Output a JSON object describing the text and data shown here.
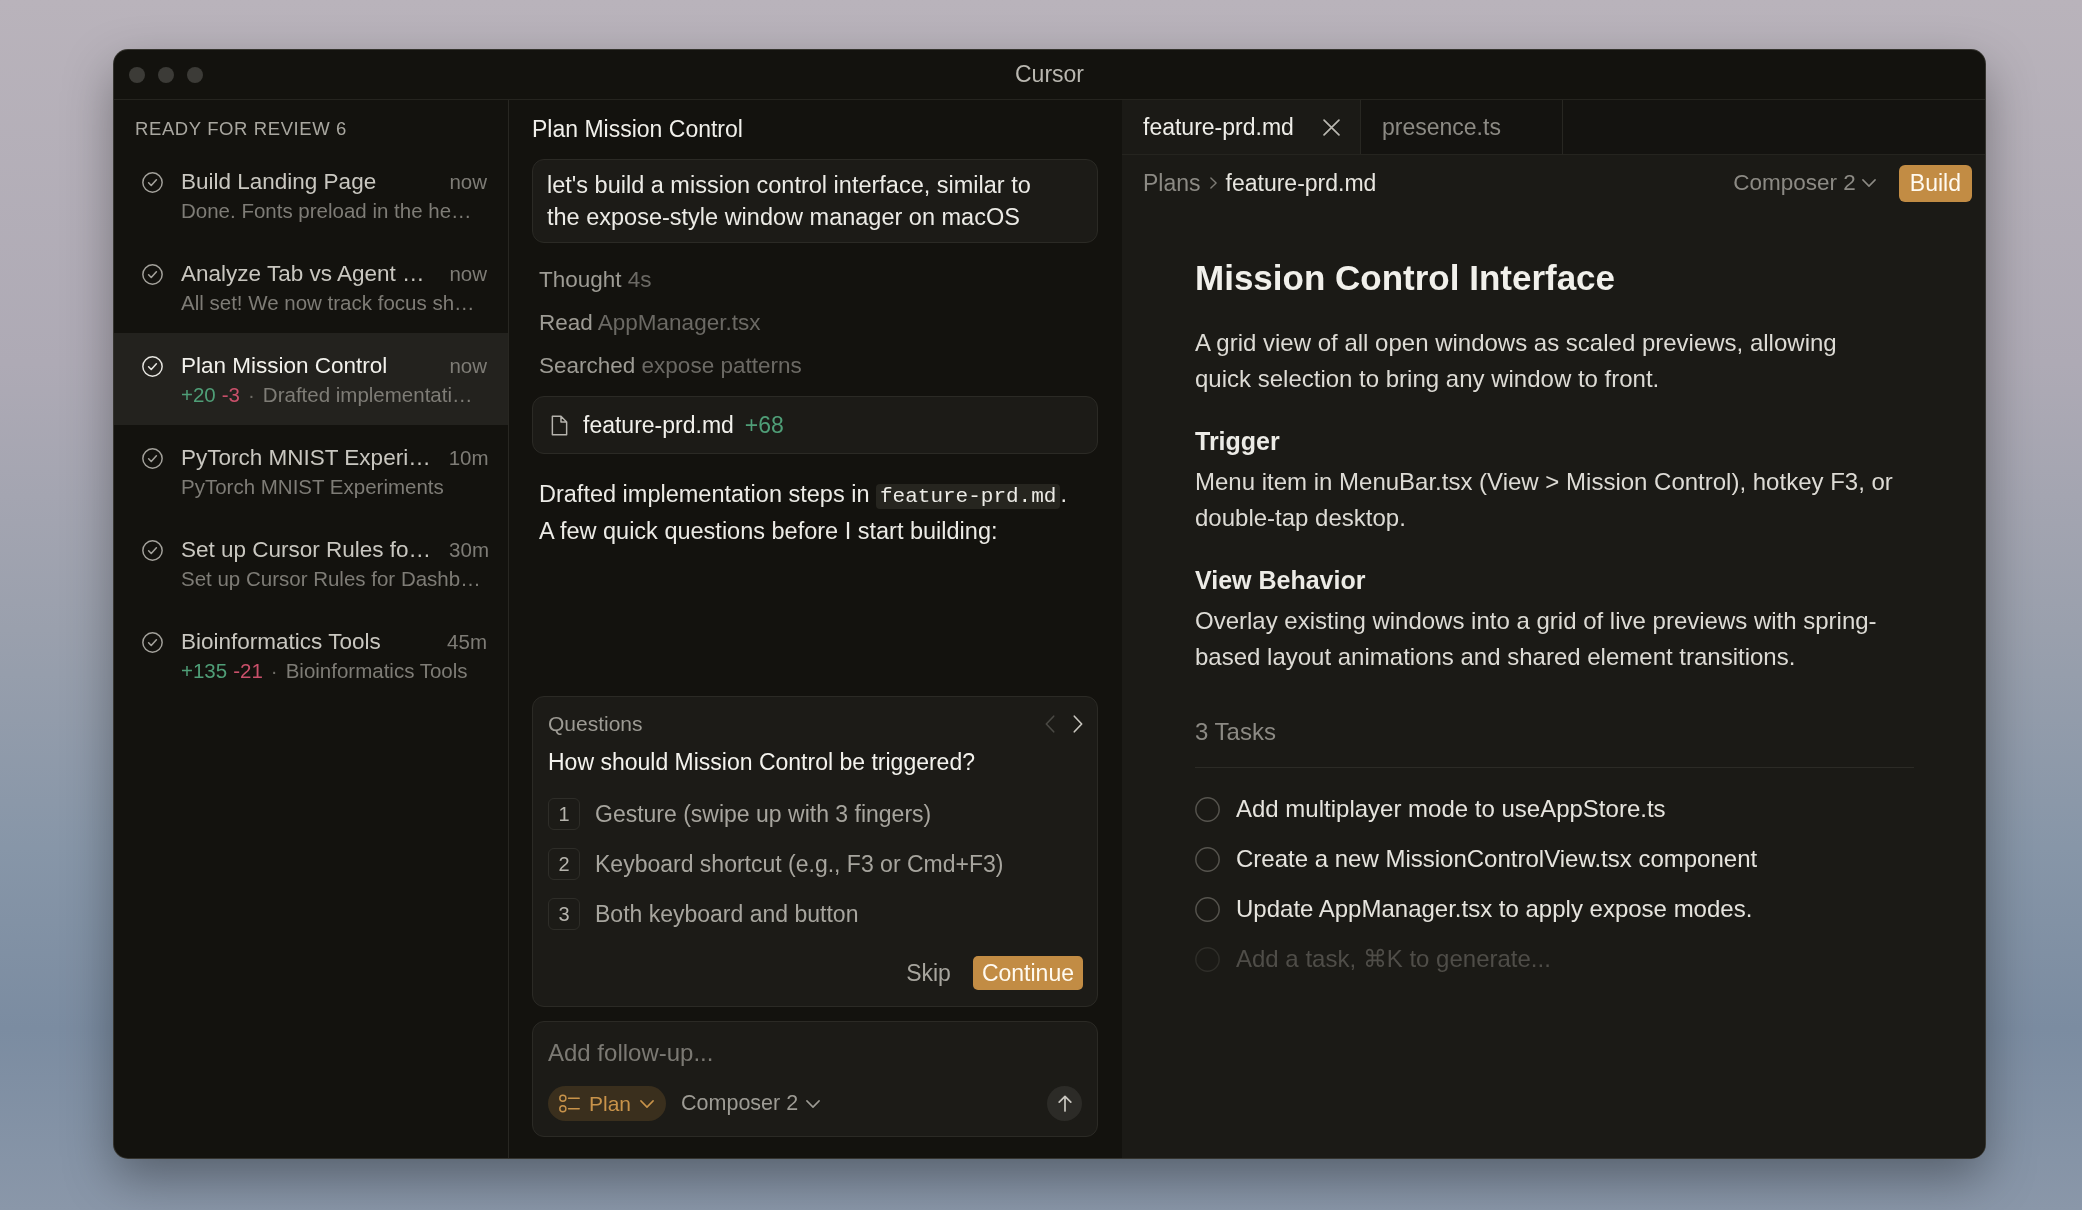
{
  "window": {
    "title": "Cursor"
  },
  "sidebar": {
    "heading": "READY FOR REVIEW 6",
    "items": [
      {
        "title": "Build Landing Page",
        "time": "now",
        "summary": "Done. Fonts preload in the he…",
        "selected": false
      },
      {
        "title": "Analyze Tab vs Agent …",
        "time": "now",
        "summary": "All set! We now track focus sh…",
        "selected": false
      },
      {
        "title": "Plan Mission Control",
        "time": "now",
        "added": "+20",
        "removed": "-3",
        "separator": "·",
        "summary": "Drafted implementati…",
        "selected": true
      },
      {
        "title": "PyTorch MNIST Experi…",
        "time": "10m",
        "summary": "PyTorch MNIST Experiments",
        "selected": false
      },
      {
        "title": "Set up Cursor Rules fo…",
        "time": "30m",
        "summary": "Set up Cursor Rules for Dashb…",
        "selected": false
      },
      {
        "title": "Bioinformatics Tools",
        "time": "45m",
        "added": "+135",
        "removed": "-21",
        "separator": "·",
        "summary": "Bioinformatics Tools",
        "selected": false
      }
    ]
  },
  "chat": {
    "title": "Plan Mission Control",
    "user_message": "let's build a mission control interface, similar to the expose-style window manager on macOS",
    "steps": [
      {
        "action": "Thought",
        "detail": "4s"
      },
      {
        "action": "Read",
        "detail": "AppManager.tsx"
      },
      {
        "action": "Searched",
        "detail": "expose patterns"
      }
    ],
    "file_card": {
      "name": "feature-prd.md",
      "added": "+68"
    },
    "response": [
      {
        "kind": "text",
        "text": "Drafted implementation steps in "
      },
      {
        "kind": "code",
        "text": "feature-prd.md"
      },
      {
        "kind": "text",
        "text": ". A few quick questions before I start building:"
      }
    ],
    "questions": {
      "label": "Questions",
      "pager": [
        {
          "kind": "previous",
          "disabled": true
        },
        {
          "kind": "next",
          "disabled": false
        }
      ],
      "question": "How should Mission Control be triggered?",
      "options": [
        {
          "key": "1",
          "text": "Gesture (swipe up with 3 fingers)"
        },
        {
          "key": "2",
          "text": "Keyboard shortcut (e.g., F3 or Cmd+F3)"
        },
        {
          "key": "3",
          "text": "Both keyboard and button"
        }
      ],
      "skip": "Skip",
      "continue": "Continue"
    },
    "composer": {
      "placeholder": "Add follow-up...",
      "mode": "Plan",
      "model": "Composer 2"
    }
  },
  "editor": {
    "tabs": [
      {
        "label": "feature-prd.md",
        "selected": true
      },
      {
        "label": "presence.ts",
        "selected": false
      }
    ],
    "breadcrumb": [
      "Plans",
      "feature-prd.md"
    ],
    "model": "Composer 2",
    "action": "Build",
    "document": {
      "title": "Mission Control Interface",
      "intro": "A grid view of all open windows as scaled previews, allowing quick selection to bring any window to front.",
      "sections": [
        {
          "heading": "Trigger",
          "body": "Menu item in MenuBar.tsx (View > Mission Control), hotkey F3, or double-tap desktop."
        },
        {
          "heading": "View Behavior",
          "body": "Overlay existing windows into a grid of live previews with spring-based layout animations and shared element transitions."
        }
      ],
      "tasks_heading": "3 Tasks",
      "tasks": [
        {
          "text": "Add multiplayer mode to useAppStore.ts",
          "checked": false
        },
        {
          "text": "Create a new MissionControlView.tsx component",
          "checked": false
        },
        {
          "text": "Update AppManager.tsx to apply expose modes.",
          "checked": false
        }
      ],
      "new_task_placeholder": "Add a task, ⌘K to generate..."
    }
  }
}
